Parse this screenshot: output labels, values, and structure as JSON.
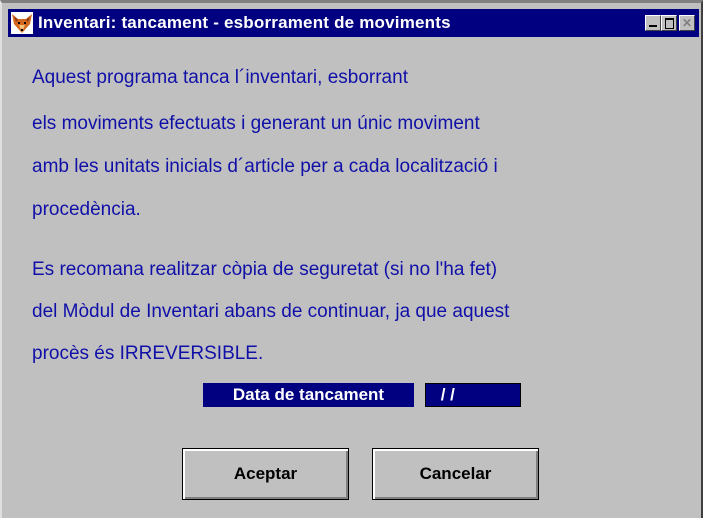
{
  "window": {
    "title": "Inventari: tancament - esborrament de moviments",
    "title_bar_color": "#000080",
    "title_text_color": "#ffffff",
    "background_color": "#c0c0c0"
  },
  "message": {
    "text_color": "#1010a8",
    "paragraph1": [
      "Aquest programa tanca l´inventari, esborrant",
      "els moviments efectuats i generant un únic moviment",
      "amb les unitats inicials d´article per a cada localització i",
      "procedència."
    ],
    "paragraph2": [
      "Es recomana realitzar còpia de seguretat (si no l'ha fet)",
      "del Mòdul de Inventari abans de continuar, ja que aquest",
      "procès és IRREVERSIBLE."
    ]
  },
  "date_field": {
    "label": "Data de tancament",
    "value": " / /",
    "field_color": "#000080"
  },
  "buttons": {
    "accept": "Aceptar",
    "cancel": "Cancelar"
  },
  "icons": {
    "app": "fox-head-icon",
    "minimize": "minimize-icon",
    "maximize": "maximize-icon",
    "close": "close-icon"
  }
}
